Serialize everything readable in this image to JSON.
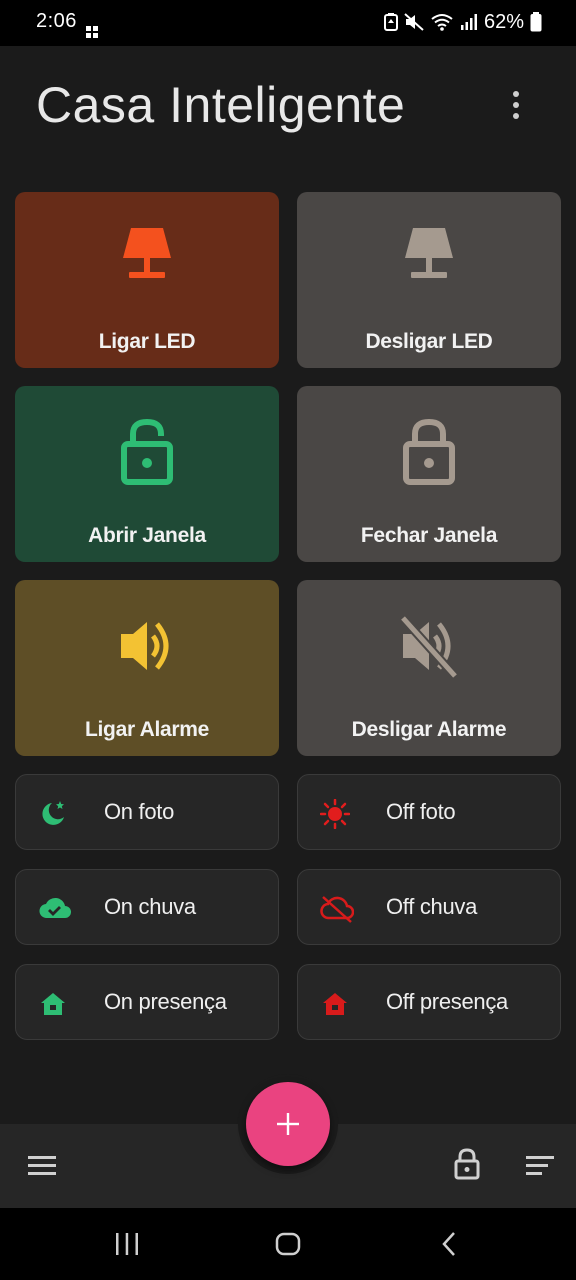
{
  "status_bar": {
    "time": "2:06",
    "battery": "62%",
    "icons": [
      "grid-icon",
      "battery-saver-icon",
      "mute-icon",
      "wifi-icon",
      "signal-icon",
      "battery-icon"
    ]
  },
  "header": {
    "title": "Casa Inteligente",
    "menu_icon": "more-vert-icon"
  },
  "tiles": [
    {
      "label": "Ligar LED",
      "icon": "lamp-icon",
      "bg": "#672c18",
      "icon_color": "#f4511e"
    },
    {
      "label": "Desligar LED",
      "icon": "lamp-icon",
      "bg": "#4a4745",
      "icon_color": "#a59a8f"
    },
    {
      "label": "Abrir Janela",
      "icon": "lock-open-icon",
      "bg": "#1f4a36",
      "icon_color": "#2ebd74"
    },
    {
      "label": "Fechar Janela",
      "icon": "lock-icon",
      "bg": "#4a4745",
      "icon_color": "#a59a8f"
    },
    {
      "label": "Ligar Alarme",
      "icon": "volume-up-icon",
      "bg": "#5e4e26",
      "icon_color": "#f3c233"
    },
    {
      "label": "Desligar Alarme",
      "icon": "volume-off-icon",
      "bg": "#4a4745",
      "icon_color": "#a59a8f"
    }
  ],
  "pills": [
    {
      "label": "On foto",
      "icon": "night-icon",
      "icon_color": "#2ebd74"
    },
    {
      "label": "Off foto",
      "icon": "sun-icon",
      "icon_color": "#e11d1d"
    },
    {
      "label": "On chuva",
      "icon": "cloud-check-icon",
      "icon_color": "#2ebd74"
    },
    {
      "label": "Off chuva",
      "icon": "cloud-off-icon",
      "icon_color": "#d81b1b"
    },
    {
      "label": "On presença",
      "icon": "home-icon",
      "icon_color": "#2ebd74"
    },
    {
      "label": "Off presença",
      "icon": "home-icon",
      "icon_color": "#d81b1b"
    }
  ],
  "bottom_bar": {
    "fab_icon": "plus-icon",
    "fab_color": "#ea4380",
    "left_icon": "menu-icon",
    "right_icons": [
      "lock-icon",
      "sort-icon"
    ]
  },
  "nav_bar": {
    "icons": [
      "recents-icon",
      "home-icon",
      "back-icon"
    ]
  }
}
